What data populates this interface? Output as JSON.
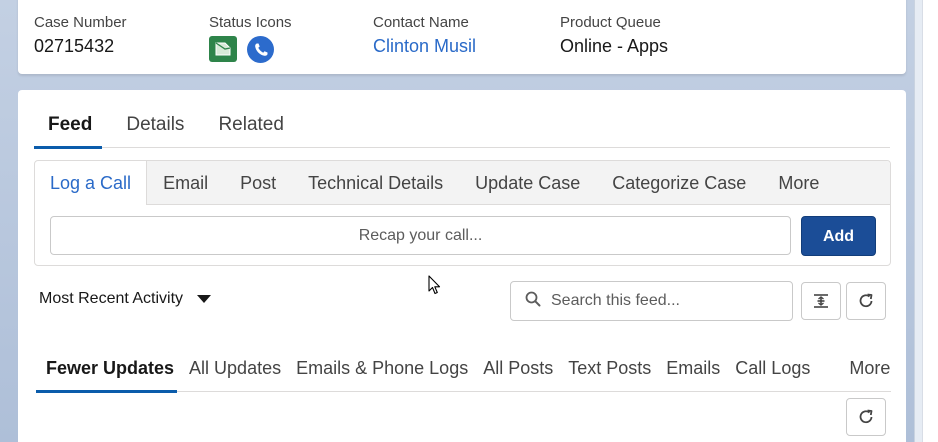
{
  "highlights": {
    "case_number_label": "Case Number",
    "case_number": "02715432",
    "status_icons_label": "Status Icons",
    "status_icons": [
      "envelope-icon",
      "phone-icon"
    ],
    "contact_name_label": "Contact Name",
    "contact_name": "Clinton Musil",
    "product_queue_label": "Product Queue",
    "product_queue": "Online - Apps"
  },
  "tabs": [
    "Feed",
    "Details",
    "Related"
  ],
  "publisher": {
    "tabs": [
      "Log a Call",
      "Email",
      "Post",
      "Technical Details",
      "Update Case",
      "Categorize Case",
      "More"
    ],
    "placeholder": "Recap your call...",
    "add_label": "Add"
  },
  "feed": {
    "sort_label": "Most Recent Activity",
    "search_placeholder": "Search this feed...",
    "filters": [
      "Fewer Updates",
      "All Updates",
      "Emails & Phone Logs",
      "All Posts",
      "Text Posts",
      "Emails",
      "Call Logs",
      "More"
    ]
  },
  "colors": {
    "brand_blue": "#0b5cab",
    "button_blue": "#1b4d97",
    "link_blue": "#2a6ac8",
    "status_green": "#2e844a"
  }
}
